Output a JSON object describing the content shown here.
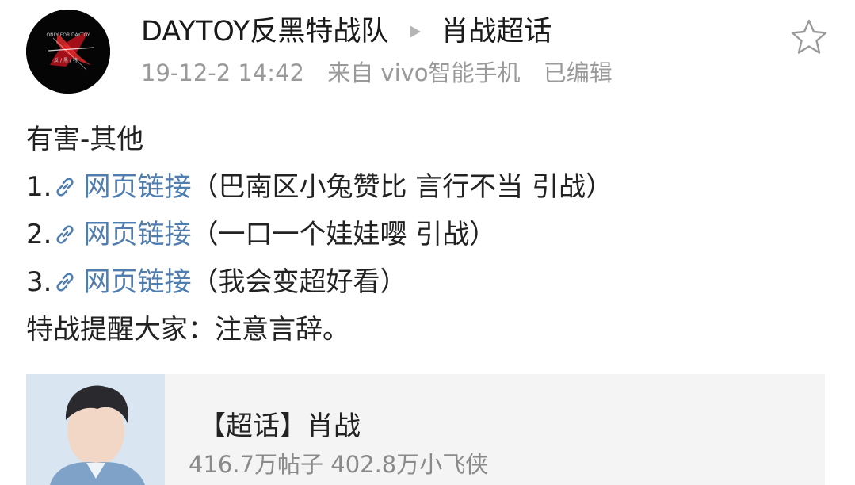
{
  "post": {
    "author": "DAYTOY反黑特战队",
    "breadcrumb_target": "肖战超话",
    "time": "19-12-2 14:42",
    "source": "来自 vivo智能手机",
    "edited": "已编辑",
    "avatar_text": "ONLY FOR DAYTOY",
    "avatar_subtext": "反 / 黑 / 特",
    "breadcrumb_icon": "triangle-right-icon",
    "favorite_icon": "star-outline-icon"
  },
  "body": {
    "heading": "有害-其他",
    "items": [
      {
        "number": "1.",
        "link": "网页链接",
        "note": "（巴南区小兔赞比 言行不当 引战）"
      },
      {
        "number": "2.",
        "link": "网页链接",
        "note": "（一口一个娃娃嘤 引战）"
      },
      {
        "number": "3.",
        "link": "网页链接",
        "note": "（我会变超好看）"
      }
    ],
    "closing": "特战提醒大家：注意言辞。",
    "link_icon": "link-icon"
  },
  "topic_card": {
    "title": "【超话】肖战",
    "stats": "416.7万帖子 402.8万小飞侠"
  },
  "colors": {
    "link": "#507daf",
    "meta": "#9a9a9a",
    "card_bg": "#f4f4f4",
    "text": "#222222"
  }
}
